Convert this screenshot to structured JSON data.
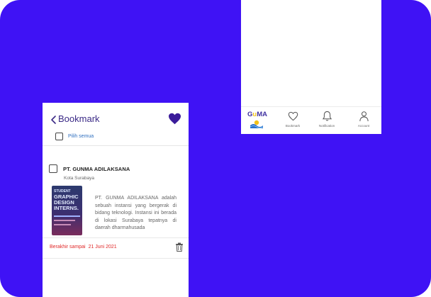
{
  "bookmark_screen": {
    "title": "Bookmark",
    "select_all_label": "Pilih semua",
    "item": {
      "company": "PT. GUNMA ADILAKSANA",
      "city": "Kota Surabaya",
      "poster": {
        "line1": "STUDENT",
        "line2": "GRAPHIC",
        "line3": "DESIGN",
        "line4": "INTERNS."
      },
      "description": "PT. GUNMA ADILAKSANA adalah sebuah instansi yang bergerak di bidang teknologi. Instansi ini berada di lokasi Surabaya tepatnya di daerah dharmahusada",
      "deadline_label": "Berakhir sampai",
      "deadline_date": "21 Juni 2021"
    }
  },
  "home_screen": {
    "logo": {
      "part1": "G",
      "part2": "u",
      "part3": "MA"
    },
    "nav": [
      {
        "label": "Bookmark",
        "icon": "heart-outline-icon"
      },
      {
        "label": "Notification",
        "icon": "bell-icon"
      },
      {
        "label": "Account",
        "icon": "user-icon"
      }
    ]
  },
  "colors": {
    "background": "#3f12f5",
    "accent": "#3b1c9a",
    "deadline": "#e02828"
  }
}
